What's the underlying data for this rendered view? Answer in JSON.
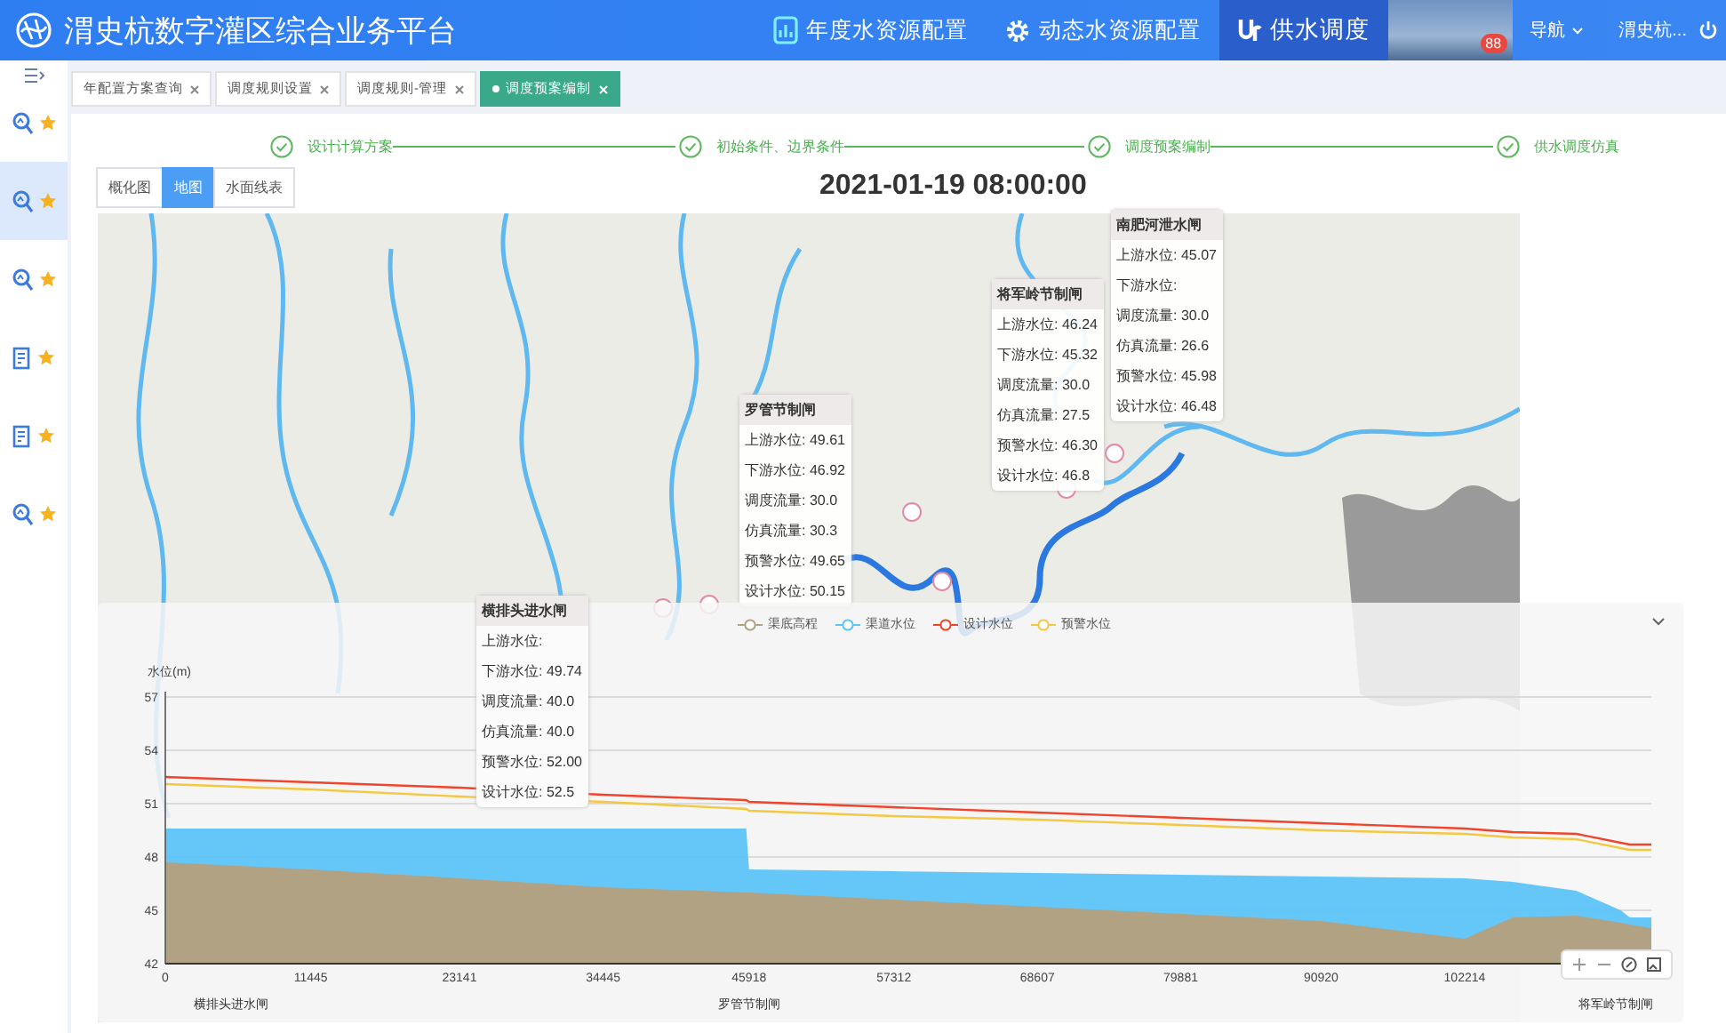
{
  "header": {
    "title": "渭史杭数字灌区综合业务平台",
    "nav": [
      {
        "label": "年度水资源配置",
        "kind": "chart",
        "selected": false
      },
      {
        "label": "动态水资源配置",
        "kind": "gear",
        "selected": false
      },
      {
        "label": "供水调度",
        "kind": "flow",
        "selected": true
      }
    ],
    "badge": "88",
    "menu": "导航",
    "user": "渭史杭..."
  },
  "sidebar": {
    "items": [
      {
        "kind": "magnifier",
        "selected": false
      },
      {
        "kind": "magnifier",
        "selected": true
      },
      {
        "kind": "magnifier",
        "selected": false
      },
      {
        "kind": "document",
        "selected": false
      },
      {
        "kind": "document",
        "selected": false
      },
      {
        "kind": "magnifier",
        "selected": false
      }
    ]
  },
  "tabs": [
    {
      "label": "年配置方案查询",
      "selected": false
    },
    {
      "label": "调度规则设置",
      "selected": false
    },
    {
      "label": "调度规则-管理",
      "selected": false
    },
    {
      "label": "调度预案编制",
      "selected": true
    }
  ],
  "steps": [
    {
      "label": "设计计算方案",
      "done": true
    },
    {
      "label": "初始条件、边界条件",
      "done": true
    },
    {
      "label": "调度预案编制",
      "done": true
    },
    {
      "label": "供水调度仿真",
      "done": true
    }
  ],
  "views": [
    {
      "label": "概化图",
      "selected": false
    },
    {
      "label": "地图",
      "selected": true
    },
    {
      "label": "水面线表",
      "selected": false
    }
  ],
  "datetime": "2021-01-19 08:00:00",
  "gates": [
    {
      "name": "横排头进水闸",
      "rows": [
        {
          "label": "上游水位:"
        },
        {
          "label": "下游水位:",
          "value": "49.74"
        },
        {
          "label": "调度流量:",
          "value": "40.0"
        },
        {
          "label": "仿真流量:",
          "value": "40.0"
        },
        {
          "label": "预警水位:",
          "value": "52.00"
        },
        {
          "label": "设计水位:",
          "value": "52.5"
        }
      ]
    },
    {
      "name": "罗管节制闸",
      "rows": [
        {
          "label": "上游水位:",
          "value": "49.61"
        },
        {
          "label": "下游水位:",
          "value": "46.92"
        },
        {
          "label": "调度流量:",
          "value": "30.0"
        },
        {
          "label": "仿真流量:",
          "value": "30.3"
        },
        {
          "label": "预警水位:",
          "value": "49.65"
        },
        {
          "label": "设计水位:",
          "value": "50.15"
        }
      ]
    },
    {
      "name": "将军岭节制闸",
      "rows": [
        {
          "label": "上游水位:",
          "value": "46.24"
        },
        {
          "label": "下游水位:",
          "value": "45.32"
        },
        {
          "label": "调度流量:",
          "value": "30.0"
        },
        {
          "label": "仿真流量:",
          "value": "27.5"
        },
        {
          "label": "预警水位:",
          "value": "46.30"
        },
        {
          "label": "设计水位:",
          "value": "46.8"
        }
      ]
    },
    {
      "name": "南肥河泄水闸",
      "rows": [
        {
          "label": "上游水位:",
          "value": "45.07"
        },
        {
          "label": "下游水位:"
        },
        {
          "label": "调度流量:",
          "value": "30.0"
        },
        {
          "label": "仿真流量:",
          "value": "26.6"
        },
        {
          "label": "预警水位:",
          "value": "45.98"
        },
        {
          "label": "设计水位:",
          "value": "46.48"
        }
      ]
    }
  ],
  "profile": {
    "chart_data": {
      "type": "area",
      "ylabel": "水位(m)",
      "x": [
        0,
        11445,
        23141,
        34445,
        45700,
        45918,
        57312,
        68607,
        79881,
        90920,
        102214,
        106000,
        111000,
        114500,
        115200,
        116900
      ],
      "series": [
        {
          "name": "渠底高程",
          "color": "#b1a283",
          "values": [
            47.7,
            47.3,
            46.8,
            46.3,
            46.0,
            46.0,
            45.6,
            45.2,
            44.8,
            44.4,
            43.4,
            44.6,
            44.7,
            44.3,
            44.2,
            44.0
          ]
        },
        {
          "name": "渠道水位",
          "color": "#5cc4f8",
          "values": [
            49.6,
            49.6,
            49.6,
            49.6,
            49.6,
            47.3,
            47.2,
            47.1,
            47.0,
            46.9,
            46.8,
            46.6,
            46.1,
            45.0,
            44.6,
            44.6
          ]
        },
        {
          "name": "设计水位",
          "type": "line",
          "color": "#f0442c",
          "values": [
            52.5,
            52.2,
            51.9,
            51.5,
            51.2,
            51.1,
            50.8,
            50.5,
            50.2,
            49.9,
            49.6,
            49.4,
            49.3,
            48.8,
            48.7,
            48.7
          ]
        },
        {
          "name": "预警水位",
          "type": "line",
          "color": "#f5c842",
          "values": [
            52.1,
            51.8,
            51.4,
            51.1,
            50.7,
            50.6,
            50.3,
            50.1,
            49.8,
            49.5,
            49.3,
            49.1,
            49.0,
            48.5,
            48.4,
            48.4
          ]
        }
      ],
      "xlim": [
        0,
        116900
      ],
      "ylim": [
        42,
        57
      ],
      "xticks": [
        0,
        11445,
        23141,
        34445,
        45918,
        57312,
        68607,
        79881,
        90920,
        102214
      ],
      "yticks": [
        42,
        45,
        48,
        51,
        54,
        57
      ],
      "grid": true,
      "legend": "top",
      "annotations": [
        "横排头进水闸",
        "罗管节制闸",
        "将军岭节制闸"
      ]
    }
  }
}
